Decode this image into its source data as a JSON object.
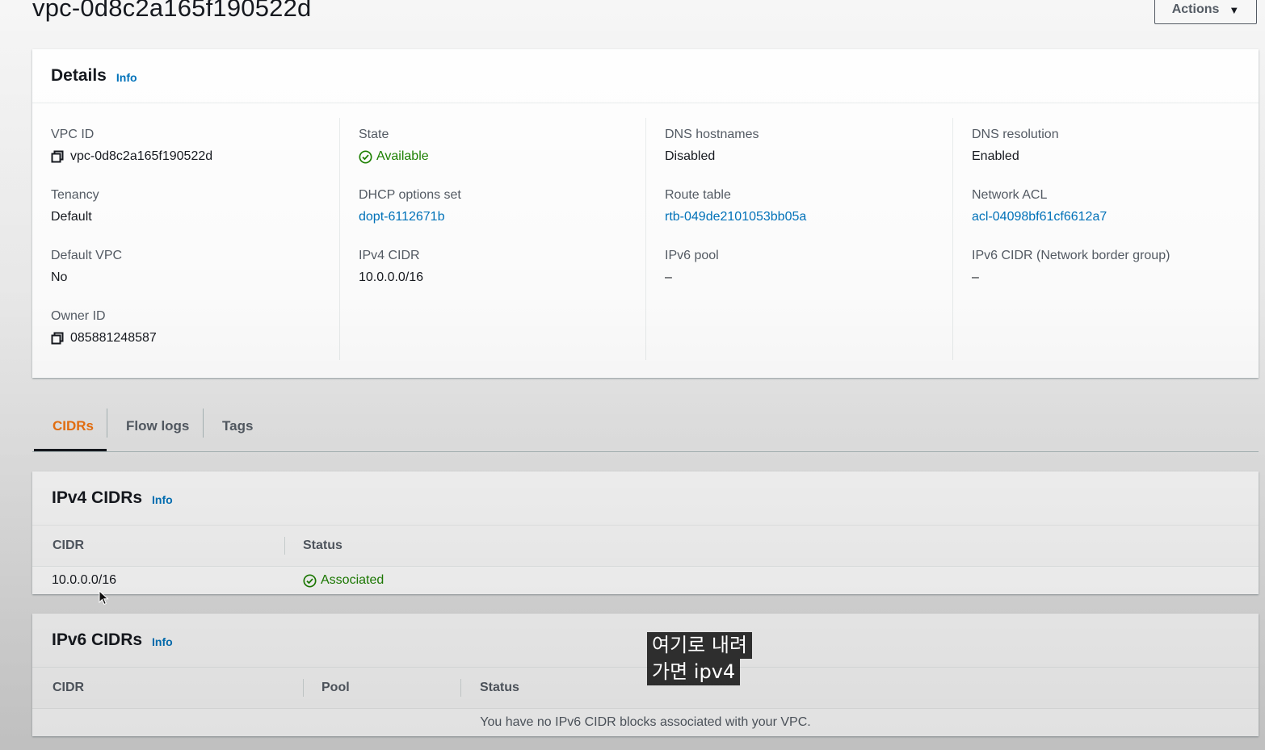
{
  "header": {
    "title": "vpc-0d8c2a165f190522d",
    "actions_label": "Actions"
  },
  "details": {
    "title": "Details",
    "info": "Info",
    "columns": [
      [
        {
          "label": "VPC ID",
          "value": "vpc-0d8c2a165f190522d",
          "kind": "copy"
        },
        {
          "label": "Tenancy",
          "value": "Default",
          "kind": "text"
        },
        {
          "label": "Default VPC",
          "value": "No",
          "kind": "text"
        },
        {
          "label": "Owner ID",
          "value": "085881248587",
          "kind": "copy"
        }
      ],
      [
        {
          "label": "State",
          "value": "Available",
          "kind": "status"
        },
        {
          "label": "DHCP options set",
          "value": "dopt-6112671b",
          "kind": "link"
        },
        {
          "label": "IPv4 CIDR",
          "value": "10.0.0.0/16",
          "kind": "text"
        }
      ],
      [
        {
          "label": "DNS hostnames",
          "value": "Disabled",
          "kind": "text"
        },
        {
          "label": "Route table",
          "value": "rtb-049de2101053bb05a",
          "kind": "link"
        },
        {
          "label": "IPv6 pool",
          "value": "–",
          "kind": "text"
        }
      ],
      [
        {
          "label": "DNS resolution",
          "value": "Enabled",
          "kind": "text"
        },
        {
          "label": "Network ACL",
          "value": "acl-04098bf61cf6612a7",
          "kind": "link"
        },
        {
          "label": "IPv6 CIDR (Network border group)",
          "value": "–",
          "kind": "text"
        }
      ]
    ]
  },
  "tabs": [
    "CIDRs",
    "Flow logs",
    "Tags"
  ],
  "ipv4": {
    "title": "IPv4 CIDRs",
    "info": "Info",
    "headers": [
      "CIDR",
      "Status"
    ],
    "rows": [
      {
        "cidr": "10.0.0.0/16",
        "status": "Associated"
      }
    ]
  },
  "ipv6": {
    "title": "IPv6 CIDRs",
    "info": "Info",
    "headers": [
      "CIDR",
      "Pool",
      "Status"
    ],
    "empty": "You have no IPv6 CIDR blocks associated with your VPC."
  },
  "subtitle": {
    "line1": "여기로 내려",
    "line2": "가면 ipv4"
  },
  "colors": {
    "link": "#0073bb",
    "success": "#1d8102",
    "active_tab": "#ec7211"
  }
}
